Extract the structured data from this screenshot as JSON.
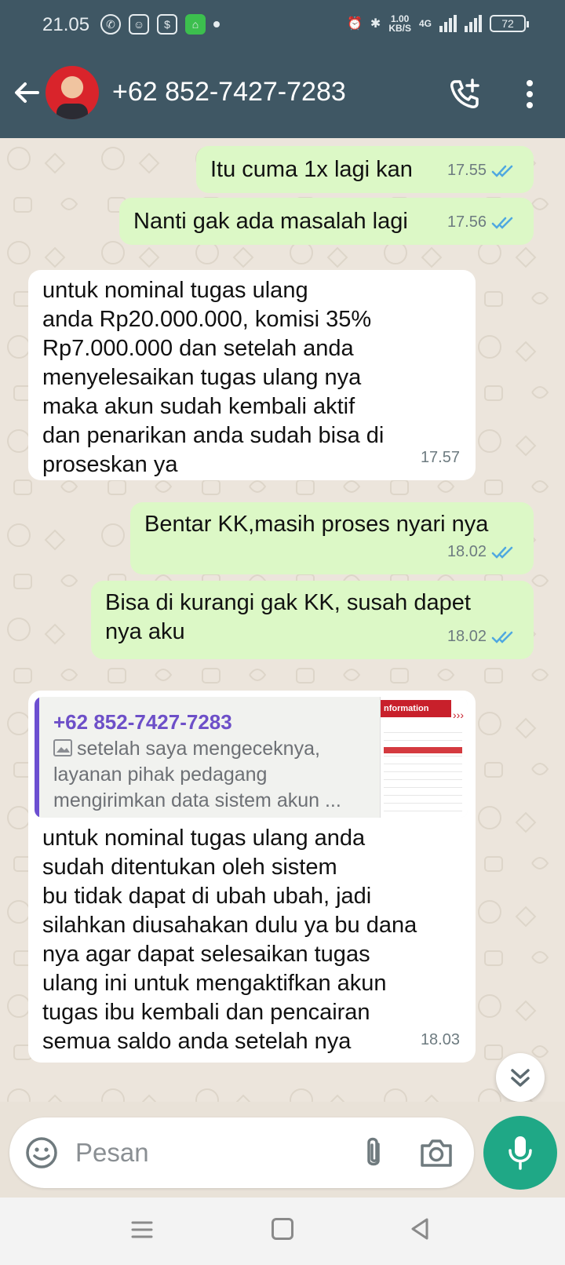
{
  "status_bar": {
    "time": "21.05",
    "net_speed_value": "1.00",
    "net_speed_unit": "KB/S",
    "network_type": "4G",
    "battery": "72"
  },
  "header": {
    "contact_name": "+62 852-7427-7283",
    "bar_color": "#3f5764"
  },
  "messages": [
    {
      "direction": "out",
      "text": "Itu cuma 1x lagi kan",
      "time": "17.55",
      "status": "read"
    },
    {
      "direction": "out",
      "text": "Nanti gak ada masalah lagi",
      "time": "17.56",
      "status": "read"
    },
    {
      "direction": "in",
      "text": "untuk nominal tugas ulang\nanda Rp20.000.000, komisi 35%\nRp7.000.000 dan setelah anda\nmenyelesaikan tugas ulang nya\nmaka akun sudah kembali aktif\ndan penarikan anda sudah bisa di\nproseskan ya",
      "time": "17.57"
    },
    {
      "direction": "out",
      "text": "Bentar KK,masih proses nyari nya",
      "time": "18.02",
      "status": "read"
    },
    {
      "direction": "out",
      "text": "Bisa di kurangi gak KK, susah dapet\nnya aku",
      "time": "18.02",
      "status": "read"
    },
    {
      "direction": "in",
      "quote": {
        "sender": "+62 852-7427-7283",
        "text": "setelah saya mengeceknya, layanan pihak pedagang mengirimkan data sistem akun ...",
        "thumb_title": "nformation"
      },
      "text": "untuk nominal tugas ulang anda\nsudah ditentukan oleh sistem\nbu tidak dapat di ubah ubah, jadi\nsilahkan diusahakan dulu ya bu dana\nnya agar dapat selesaikan tugas\nulang ini untuk mengaktifkan akun\ntugas ibu kembali dan pencairan\nsemua saldo anda setelah nya",
      "time": "18.03"
    }
  ],
  "composer": {
    "placeholder": "Pesan"
  },
  "colors": {
    "outgoing_bubble": "#dcf8c6",
    "incoming_bubble": "#ffffff",
    "read_ticks": "#4fa8e0",
    "mic_button": "#1fa886",
    "quote_accent": "#6c4fd1"
  },
  "icons": {
    "back": "arrow-left-icon",
    "call": "add-call-icon",
    "menu": "vertical-dots-icon",
    "emoji": "emoji-icon",
    "attach": "paperclip-icon",
    "camera": "camera-icon",
    "mic": "microphone-icon",
    "scroll": "double-chevron-down-icon"
  }
}
